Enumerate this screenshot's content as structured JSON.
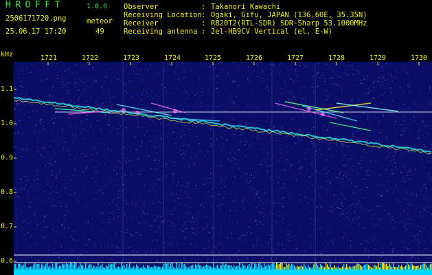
{
  "header": {
    "app_title": "HROFFT",
    "app_version": "1.0.0",
    "file_name": "2506171720.png",
    "meteor_label": "meteor",
    "meteor_count": "49",
    "timestamp": "25.06.17 17:20"
  },
  "info": {
    "rows": [
      {
        "label": "Observer",
        "value": "Takanori Kawachi"
      },
      {
        "label": "Receiving Location",
        "value": "Ogaki, Gifu, JAPAN (136.60E, 35.35N)"
      },
      {
        "label": "Receiver",
        "value": "R820T2(RTL-SDR) SDR-Sharp 53.1000MHz"
      },
      {
        "label": "Receiving antenna",
        "value": "2el-HB9CV Vertical (el. E-W)"
      }
    ],
    "separator": ":"
  },
  "axis": {
    "y_unit": "kHz",
    "x_ticks": [
      "1721",
      "1722",
      "1723",
      "1724",
      "1725",
      "1726",
      "1727",
      "1728",
      "1729",
      "1730"
    ],
    "y_ticks": [
      "1.1",
      "1.0",
      "0.9",
      "0.8",
      "0.7",
      "0.6"
    ]
  },
  "colors": {
    "background": "#0a0e64",
    "label_yellow": "#f2f200",
    "title_green": "#2ee82e",
    "trace_cyan": "#00e8ff"
  }
}
